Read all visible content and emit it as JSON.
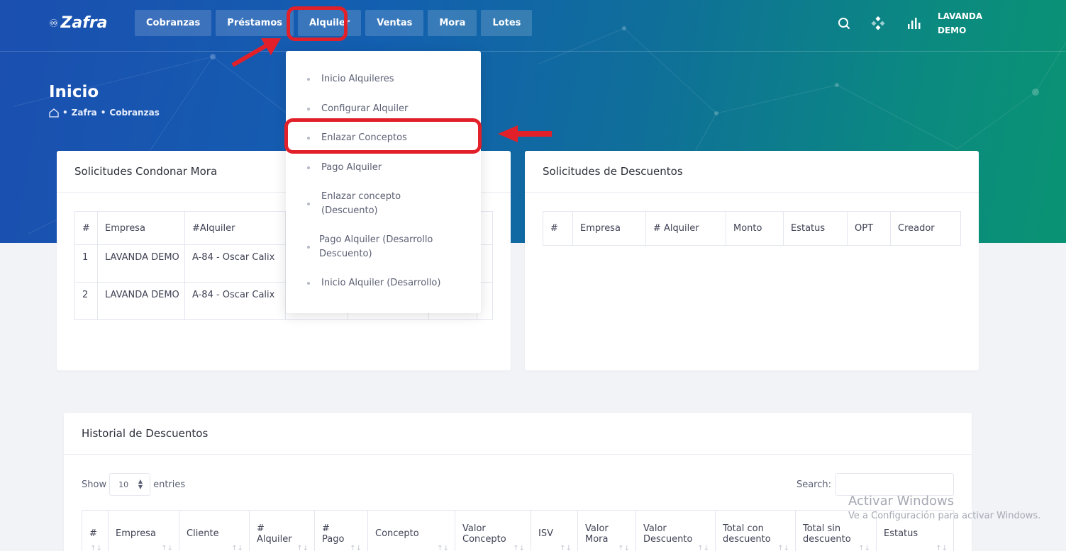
{
  "app": {
    "logo": "Zafra",
    "logo_mark": "♾"
  },
  "nav": {
    "items": [
      {
        "label": "Cobranzas"
      },
      {
        "label": "Préstamos"
      },
      {
        "label": "Alquiler"
      },
      {
        "label": "Ventas"
      },
      {
        "label": "Mora"
      },
      {
        "label": "Lotes"
      }
    ],
    "active": "Alquiler"
  },
  "user": {
    "line1": "LAVANDA",
    "line2": "DEMO"
  },
  "header": {
    "title": "Inicio",
    "breadcrumb": [
      "Zafra",
      "Cobranzas"
    ]
  },
  "dropdown": {
    "items": [
      {
        "label": "Inicio Alquileres"
      },
      {
        "label": "Configurar Alquiler"
      },
      {
        "label": "Enlazar Conceptos"
      },
      {
        "label": "Pago Alquiler"
      },
      {
        "label": "Enlazar concepto (Descuento)"
      },
      {
        "label": "Pago Alquiler (Desarrollo Descuento)"
      },
      {
        "label": "Inicio Alquiler (Desarrollo)"
      }
    ],
    "highlighted": "Enlazar Conceptos"
  },
  "condonar": {
    "title": "Solicitudes Condonar Mora",
    "columns": [
      "#",
      "Empresa",
      "#Alquiler"
    ],
    "rows": [
      [
        "1",
        "LAVANDA DEMO",
        "A-84 - Oscar Calix"
      ],
      [
        "2",
        "LAVANDA DEMO",
        "A-84 - Oscar Calix"
      ]
    ]
  },
  "descuentos": {
    "title": "Solicitudes de Descuentos",
    "columns": [
      "#",
      "Empresa",
      "# Alquiler",
      "Monto",
      "Estatus",
      "OPT",
      "Creador"
    ]
  },
  "historial": {
    "title": "Historial de Descuentos",
    "show_label": "Show",
    "entries_value": "10",
    "entries_label": "entries",
    "search_label": "Search:",
    "search_value": "",
    "columns": [
      "#",
      "Empresa",
      "Cliente",
      "# Alquiler",
      "# Pago",
      "Concepto",
      "Valor Concepto",
      "ISV",
      "Valor Mora",
      "Valor Descuento",
      "Total con descuento",
      "Total sin descuento",
      "Estatus"
    ]
  },
  "watermark": {
    "title": "Activar Windows",
    "subtitle": "Ve a Configuración para activar Windows."
  },
  "colors": {
    "accent_red": "#e2202a",
    "hero_start": "#1b4fb0",
    "hero_end": "#0a9373"
  }
}
